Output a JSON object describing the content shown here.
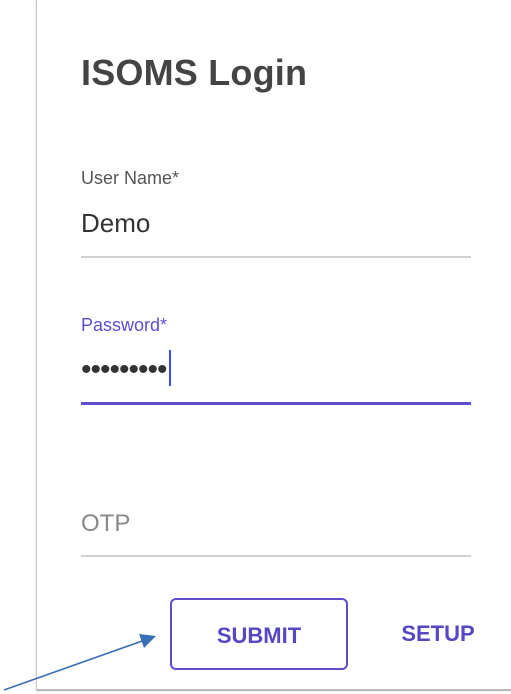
{
  "login": {
    "title": "ISOMS Login",
    "username": {
      "label": "User Name*",
      "value": "Demo"
    },
    "password": {
      "label": "Password*",
      "value": "•••••••••"
    },
    "otp": {
      "placeholder": "OTP"
    },
    "buttons": {
      "submit": "SUBMIT",
      "setup": "SETUP"
    }
  },
  "colors": {
    "accent": "#5c4ecf",
    "button_text": "#5548c2",
    "title": "#444444",
    "annotation_arrow": "#3a6fb5"
  },
  "annotation": {
    "arrow_target": "submit-button"
  }
}
